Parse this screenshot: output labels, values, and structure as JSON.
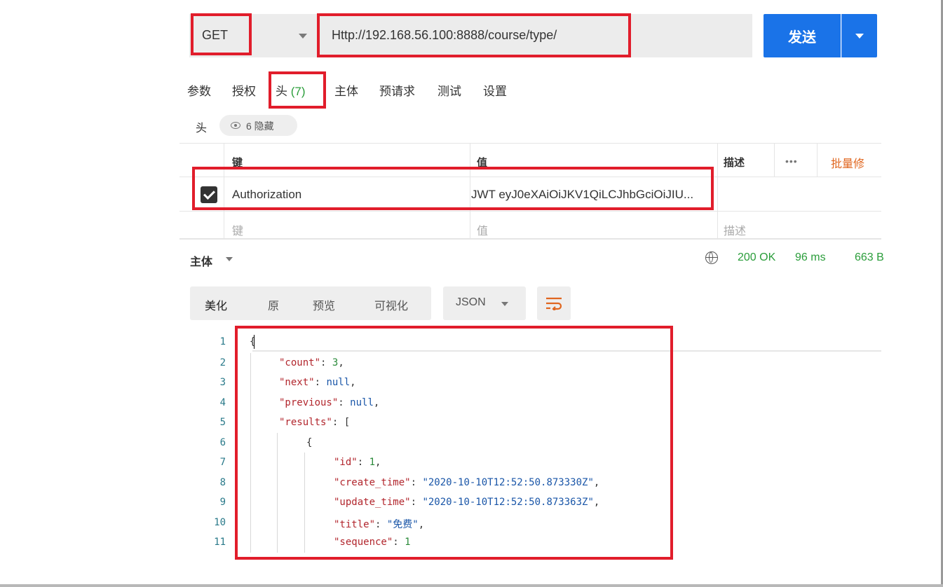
{
  "request": {
    "method": "GET",
    "url": "Http://192.168.56.100:8888/course/type/",
    "send_label": "发送"
  },
  "tabs": [
    {
      "label": "参数"
    },
    {
      "label": "授权"
    },
    {
      "label": "头",
      "count": "(7)"
    },
    {
      "label": "主体"
    },
    {
      "label": "预请求"
    },
    {
      "label": "测试"
    },
    {
      "label": "设置"
    }
  ],
  "headers_section": {
    "label": "头",
    "hidden_label": "6 隐藏"
  },
  "headers_table": {
    "columns": {
      "key": "键",
      "value": "值",
      "description": "描述",
      "more": "•••",
      "bulk_edit": "批量修"
    },
    "rows": [
      {
        "checked": true,
        "key": "Authorization",
        "value": "JWT eyJ0eXAiOiJKV1QiLCJhbGciOiJIU..."
      }
    ],
    "placeholder": {
      "key": "键",
      "value": "值",
      "description": "描述"
    }
  },
  "response": {
    "body_label": "主体",
    "status": "200 OK",
    "time": "96 ms",
    "size": "663 B",
    "views": [
      "美化",
      "原",
      "预览",
      "可视化"
    ],
    "active_view": "美化",
    "format": "JSON"
  },
  "code_lines": [
    {
      "n": "1",
      "text": "{"
    },
    {
      "n": "2",
      "text": "\"count\": 3,"
    },
    {
      "n": "3",
      "text": "\"next\": null,"
    },
    {
      "n": "4",
      "text": "\"previous\": null,"
    },
    {
      "n": "5",
      "text": "\"results\": ["
    },
    {
      "n": "6",
      "text": "{"
    },
    {
      "n": "7",
      "text": "\"id\": 1,"
    },
    {
      "n": "8",
      "text": "\"create_time\": \"2020-10-10T12:52:50.873330Z\","
    },
    {
      "n": "9",
      "text": "\"update_time\": \"2020-10-10T12:52:50.873363Z\","
    },
    {
      "n": "10",
      "text": "\"title\": \"免费\","
    },
    {
      "n": "11",
      "text": "\"sequence\": 1"
    }
  ],
  "colors": {
    "send_button": "#1a73e8",
    "status_ok": "#2a9d3a",
    "bulk_edit": "#e0661f",
    "annotation": "#e11d2b",
    "json_key": "#b2262d",
    "json_string": "#1a56a8",
    "json_number": "#2a8a3a"
  },
  "icons": {
    "method_dropdown": "chevron-down-icon",
    "send_dropdown": "chevron-down-icon",
    "hidden_headers": "eye-icon",
    "checkbox": "checkbox-checked-icon",
    "network": "globe-icon",
    "wrap": "wrap-lines-icon"
  }
}
